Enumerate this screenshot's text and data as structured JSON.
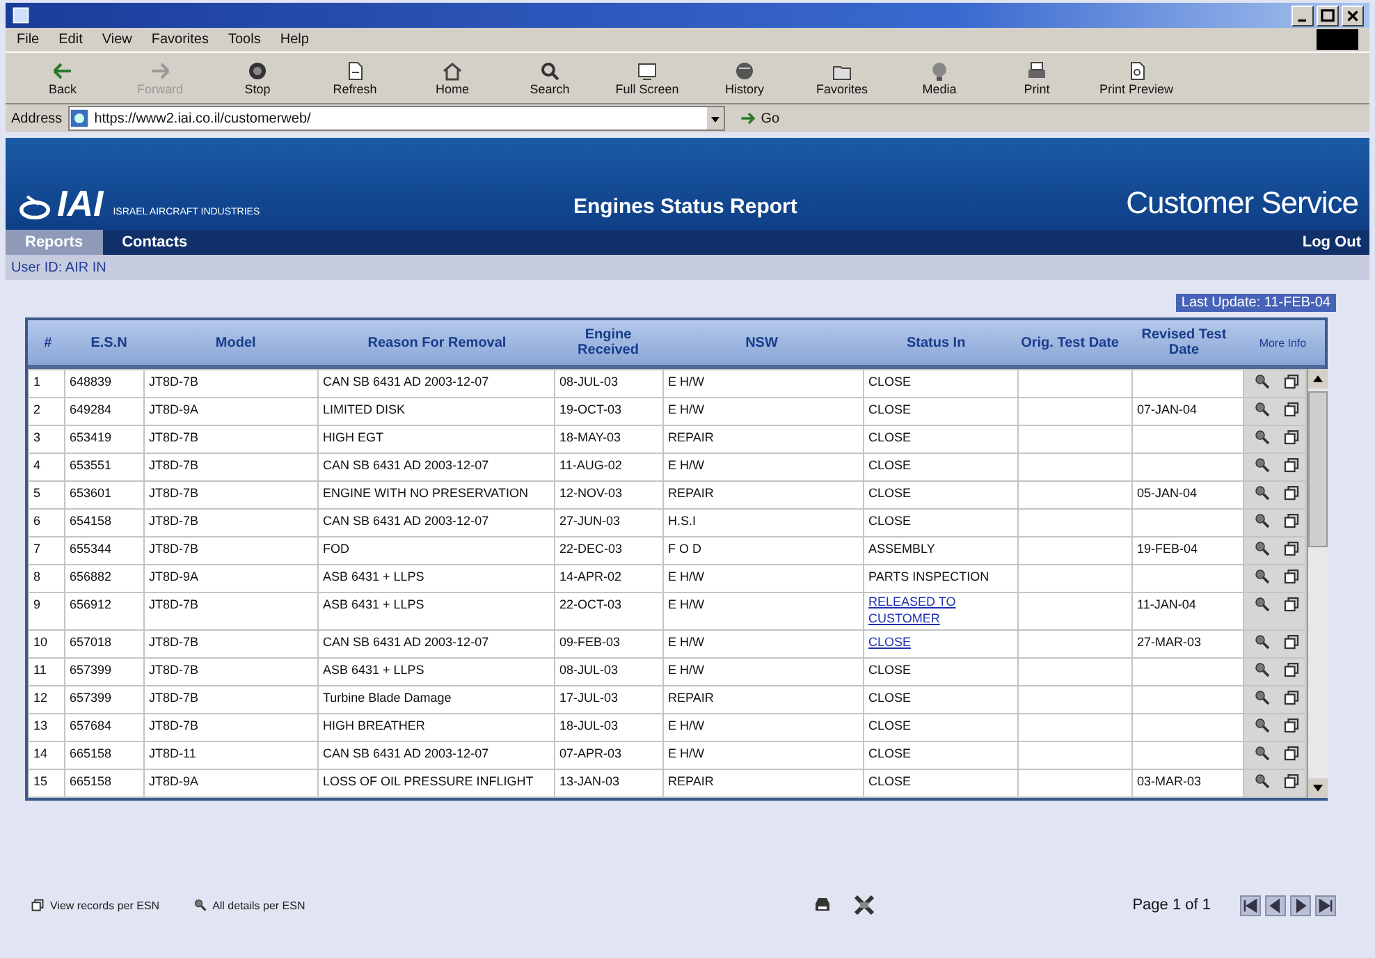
{
  "menu": [
    "File",
    "Edit",
    "View",
    "Favorites",
    "Tools",
    "Help"
  ],
  "toolbar": [
    {
      "label": "Back",
      "kind": "back",
      "disabled": false
    },
    {
      "label": "Forward",
      "kind": "forward",
      "disabled": true
    },
    {
      "label": "Stop",
      "kind": "stop",
      "disabled": false
    },
    {
      "label": "Refresh",
      "kind": "refresh",
      "disabled": false
    },
    {
      "label": "Home",
      "kind": "home",
      "disabled": false
    },
    {
      "label": "Search",
      "kind": "search",
      "disabled": false
    },
    {
      "label": "Full Screen",
      "kind": "screen",
      "disabled": false
    },
    {
      "label": "History",
      "kind": "history",
      "disabled": false
    },
    {
      "label": "Favorites",
      "kind": "favorites",
      "disabled": false
    },
    {
      "label": "Media",
      "kind": "media",
      "disabled": false
    },
    {
      "label": "Print",
      "kind": "print",
      "disabled": false
    },
    {
      "label": "Print Preview",
      "kind": "preview",
      "disabled": false
    }
  ],
  "address": {
    "label": "Address",
    "value": "https://www2.iai.co.il/customerweb/",
    "go": "Go"
  },
  "header": {
    "logo": "IAI",
    "company": "ISRAEL AIRCRAFT INDUSTRIES",
    "title": "Engines Status Report",
    "section": "Customer Service"
  },
  "nav": {
    "tabs": [
      {
        "label": "Reports",
        "selected": true
      },
      {
        "label": "Contacts",
        "selected": false
      }
    ],
    "logout": "Log Out"
  },
  "user": {
    "label": "User ID:",
    "value": "AIR IN"
  },
  "last_update": "Last Update: 11-FEB-04",
  "table": {
    "columns": [
      "#",
      "E.S.N",
      "Model",
      "Reason For Removal",
      "Engine Received",
      "NSW",
      "Status In",
      "Orig. Test Date",
      "Revised Test Date",
      "More Info"
    ],
    "rows": [
      {
        "num": "1",
        "esn": "648839",
        "model": "JT8D-7B",
        "reason": "CAN SB 6431 AD 2003-12-07",
        "received": "08-JUL-03",
        "type": "E H/W",
        "status": "CLOSE",
        "status_link": false
      },
      {
        "num": "2",
        "esn": "649284",
        "model": "JT8D-9A",
        "reason": "LIMITED DISK",
        "received": "19-OCT-03",
        "type": "E H/W",
        "status": "CLOSE",
        "status_link": false,
        "revised": "07-JAN-04"
      },
      {
        "num": "3",
        "esn": "653419",
        "model": "JT8D-7B",
        "reason": "HIGH EGT",
        "received": "18-MAY-03",
        "type": "REPAIR",
        "status": "CLOSE",
        "status_link": false
      },
      {
        "num": "4",
        "esn": "653551",
        "model": "JT8D-7B",
        "reason": "CAN SB 6431 AD 2003-12-07",
        "received": "11-AUG-02",
        "type": "E H/W",
        "status": "CLOSE",
        "status_link": false
      },
      {
        "num": "5",
        "esn": "653601",
        "model": "JT8D-7B",
        "reason": "ENGINE WITH NO PRESERVATION",
        "received": "12-NOV-03",
        "type": "REPAIR",
        "status": "CLOSE",
        "status_link": false,
        "revised": "05-JAN-04"
      },
      {
        "num": "6",
        "esn": "654158",
        "model": "JT8D-7B",
        "reason": "CAN SB 6431 AD 2003-12-07",
        "received": "27-JUN-03",
        "type": "H.S.I",
        "status": "CLOSE",
        "status_link": false
      },
      {
        "num": "7",
        "esn": "655344",
        "model": "JT8D-7B",
        "reason": "FOD",
        "received": "22-DEC-03",
        "type": "F O D",
        "status": "ASSEMBLY",
        "status_link": false,
        "revised": "19-FEB-04"
      },
      {
        "num": "8",
        "esn": "656882",
        "model": "JT8D-9A",
        "reason": "ASB 6431 + LLPS",
        "received": "14-APR-02",
        "type": "E H/W",
        "status": "PARTS INSPECTION",
        "status_link": false
      },
      {
        "num": "9",
        "esn": "656912",
        "model": "JT8D-7B",
        "reason": "ASB 6431 + LLPS",
        "received": "22-OCT-03",
        "type": "E H/W",
        "status": "RELEASED TO CUSTOMER",
        "status_link": true,
        "revised": "11-JAN-04"
      },
      {
        "num": "10",
        "esn": "657018",
        "model": "JT8D-7B",
        "reason": "CAN SB 6431 AD 2003-12-07",
        "received": "09-FEB-03",
        "type": "E H/W",
        "status": "CLOSE",
        "status_link": true,
        "revised": "27-MAR-03"
      },
      {
        "num": "11",
        "esn": "657399",
        "model": "JT8D-7B",
        "reason": "ASB 6431 + LLPS",
        "received": "08-JUL-03",
        "type": "E H/W",
        "status": "CLOSE",
        "status_link": false
      },
      {
        "num": "12",
        "esn": "657399",
        "model": "JT8D-7B",
        "reason": "Turbine Blade Damage",
        "received": "17-JUL-03",
        "type": "REPAIR",
        "status": "CLOSE",
        "status_link": false
      },
      {
        "num": "13",
        "esn": "657684",
        "model": "JT8D-7B",
        "reason": "HIGH BREATHER",
        "received": "18-JUL-03",
        "type": "E H/W",
        "status": "CLOSE",
        "status_link": false
      },
      {
        "num": "14",
        "esn": "665158",
        "model": "JT8D-11",
        "reason": "CAN SB 6431 AD 2003-12-07",
        "received": "07-APR-03",
        "type": "E H/W",
        "status": "CLOSE",
        "status_link": false
      },
      {
        "num": "15",
        "esn": "665158",
        "model": "JT8D-9A",
        "reason": "LOSS OF OIL PRESSURE INFLIGHT",
        "received": "13-JAN-03",
        "type": "REPAIR",
        "status": "CLOSE",
        "status_link": false,
        "revised": "03-MAR-03"
      }
    ]
  },
  "footer": {
    "links": [
      {
        "label": "View records per ESN",
        "kind": "copy"
      },
      {
        "label": "All details per ESN",
        "kind": "magnifier"
      }
    ],
    "page": "Page 1 of 1"
  }
}
